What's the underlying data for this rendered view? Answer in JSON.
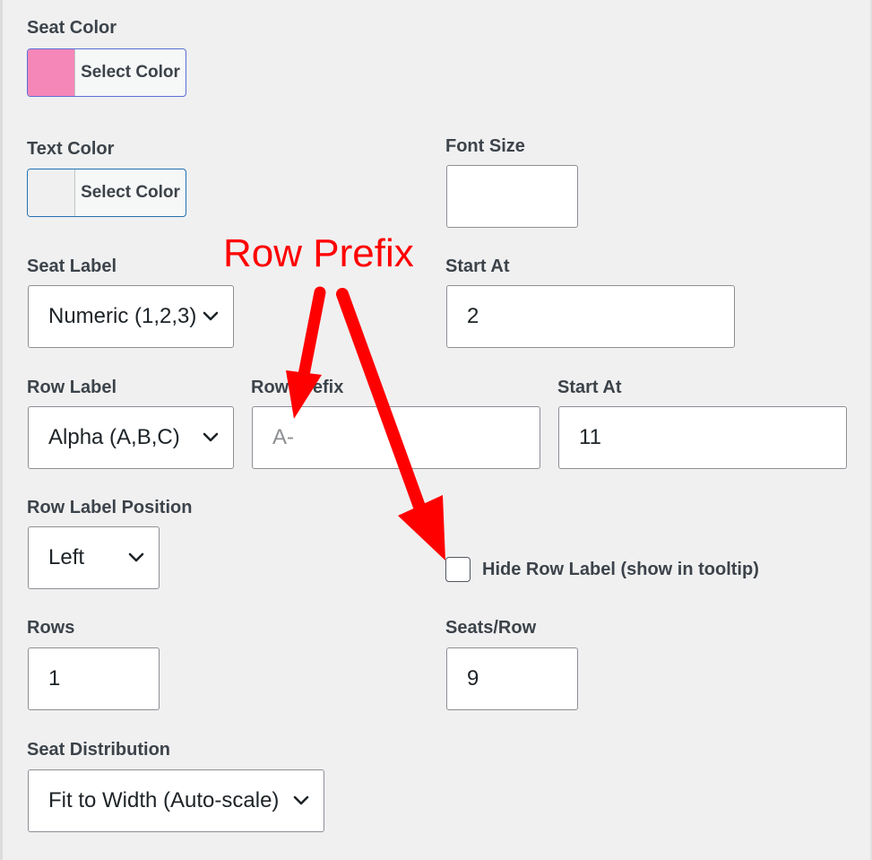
{
  "seat_color": {
    "label": "Seat Color",
    "button_text": "Select Color",
    "swatch_color": "#f587b8"
  },
  "text_color": {
    "label": "Text Color",
    "button_text": "Select Color",
    "swatch_color": "#f0f0f1"
  },
  "font_size": {
    "label": "Font Size",
    "value": ""
  },
  "seat_label": {
    "label": "Seat Label",
    "value": "Numeric (1,2,3)"
  },
  "seat_start_at": {
    "label": "Start At",
    "value": "2"
  },
  "row_label": {
    "label": "Row Label",
    "value": "Alpha (A,B,C)"
  },
  "row_prefix": {
    "label": "Row Prefix",
    "placeholder": "A-",
    "value": ""
  },
  "row_start_at": {
    "label": "Start At",
    "value": "11"
  },
  "row_label_position": {
    "label": "Row Label Position",
    "value": "Left"
  },
  "hide_row_label": {
    "label": "Hide Row Label (show in tooltip)",
    "checked": false
  },
  "rows": {
    "label": "Rows",
    "value": "1"
  },
  "seats_per_row": {
    "label": "Seats/Row",
    "value": "9"
  },
  "seat_distribution": {
    "label": "Seat Distribution",
    "value": "Fit to Width (Auto-scale)"
  },
  "annotation": {
    "text": "Row Prefix",
    "color": "#ff0000"
  },
  "icons": {
    "dropdown": "chevron-down-icon"
  }
}
